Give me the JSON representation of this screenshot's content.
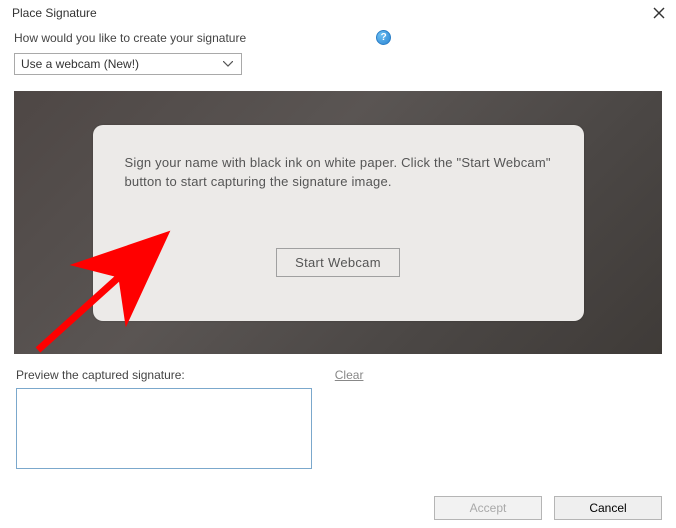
{
  "dialog": {
    "title": "Place Signature"
  },
  "prompt": {
    "label": "How would you like to create your signature",
    "help_glyph": "?"
  },
  "dropdown": {
    "selected": "Use a webcam (New!)"
  },
  "webcam": {
    "instruction": "Sign your name with black ink on white paper. Click the \"Start Webcam\" button to start capturing the signature image.",
    "start_label": "Start Webcam"
  },
  "preview": {
    "label": "Preview the captured signature:",
    "clear_label": "Clear"
  },
  "footer": {
    "accept_label": "Accept",
    "cancel_label": "Cancel"
  }
}
